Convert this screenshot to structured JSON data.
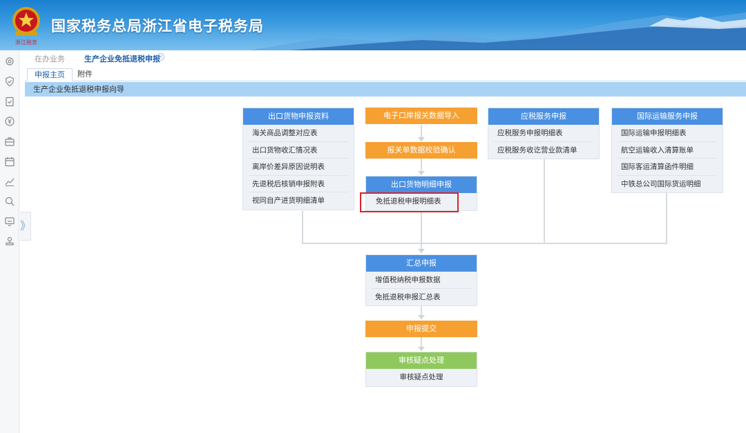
{
  "header": {
    "title": "国家税务总局浙江省电子税务局",
    "emblem_icon": "tax-emblem-icon"
  },
  "rail": {
    "icons": [
      "gear-icon",
      "shield-check-icon",
      "clipboard-check-icon",
      "yuan-circle-icon",
      "briefcase-icon",
      "calendar-icon",
      "chart-line-icon",
      "search-icon",
      "monitor-icon",
      "user-stamp-icon"
    ],
    "collapse_label": "》"
  },
  "top_tabs": {
    "in_office": "在办业务",
    "current": "生产企业免抵退税申报",
    "close": "✕"
  },
  "sub_tabs": {
    "main": "申报主页",
    "attachment": "附件"
  },
  "guide": {
    "title": "生产企业免抵退税申报向导"
  },
  "flow": {
    "export_goods": {
      "title": "出口货物申报资料",
      "items": [
        "海关商品调整对应表",
        "出口货物收汇情况表",
        "离岸价差异原因说明表",
        "先退税后核销申报附表",
        "视同自产进货明细清单"
      ]
    },
    "port_import": {
      "title": "电子口岸报关数据导入"
    },
    "customs_check": {
      "title": "报关单数据校验确认"
    },
    "export_detail": {
      "title": "出口货物明细申报",
      "items": [
        "免抵退税申报明细表"
      ]
    },
    "taxable_service": {
      "title": "应税服务申报",
      "items": [
        "应税服务申报明细表",
        "应税服务收讫营业款清单"
      ]
    },
    "intl_transport": {
      "title": "国际运输服务申报",
      "items": [
        "国际运输申报明细表",
        "航空运输收入清算账单",
        "国际客运清算函件明细",
        "中铁总公司国际货运明细"
      ]
    },
    "summary": {
      "title": "汇总申报",
      "items": [
        "增值税纳税申报数据",
        "免抵退税申报汇总表"
      ]
    },
    "submit": {
      "title": "申报提交"
    },
    "review": {
      "title": "审核疑点处理",
      "items": [
        "审核疑点处理"
      ]
    }
  },
  "colors": {
    "blue_head": "#4a90e2",
    "orange_head": "#f6a032",
    "green_head": "#8fc95d",
    "highlight": "#d9232a",
    "guide_bar": "#a9d3f5"
  }
}
